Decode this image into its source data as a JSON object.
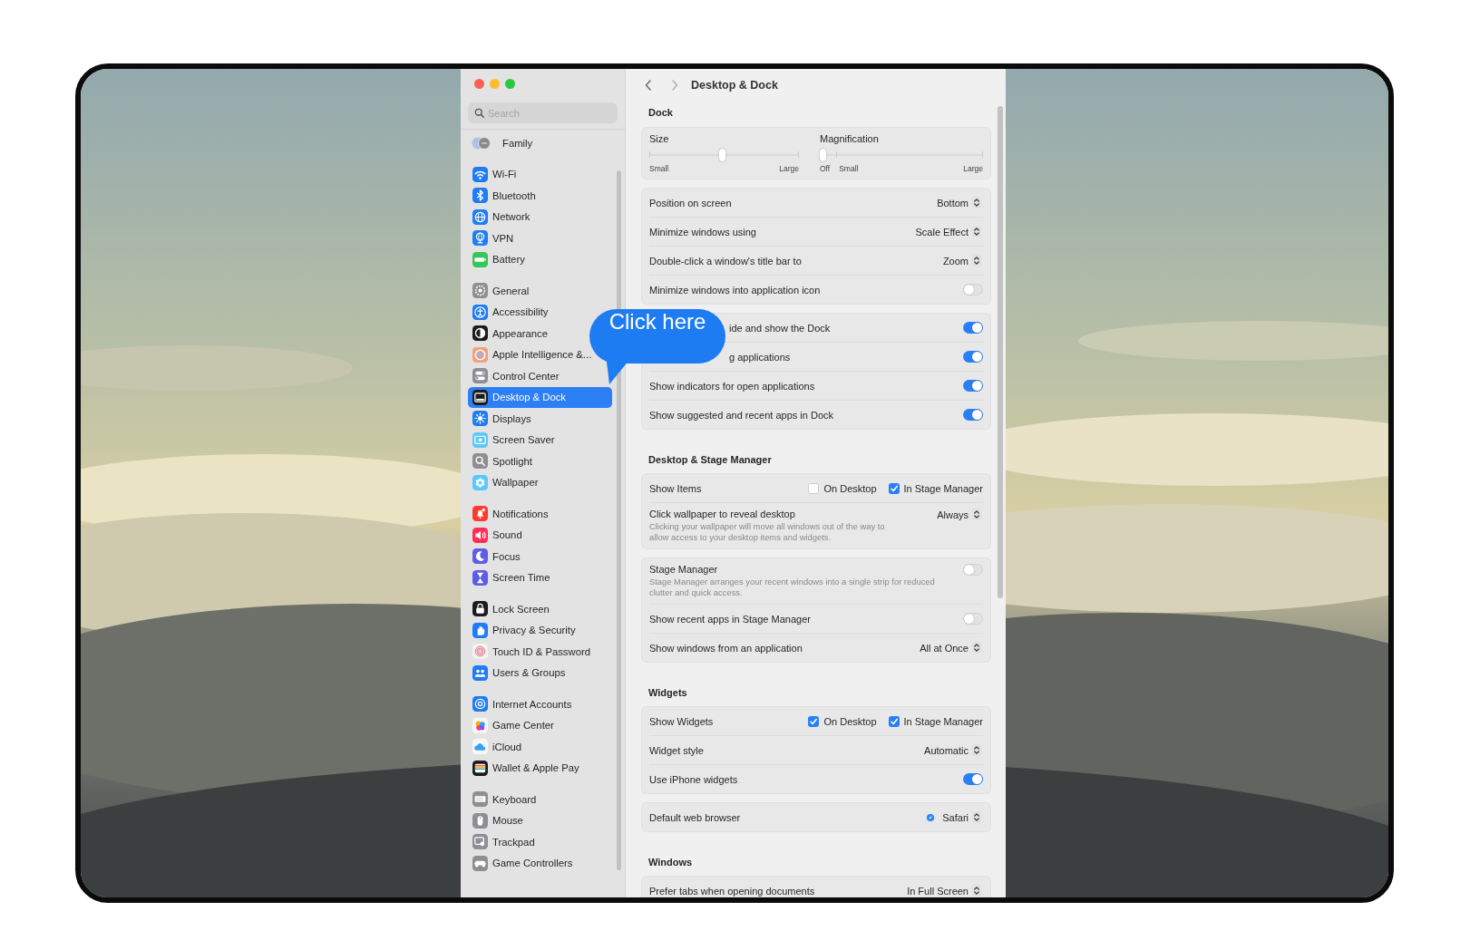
{
  "sidebar": {
    "search": {
      "placeholder": "Search"
    },
    "groups": [
      {
        "items": [
          {
            "label": "Family",
            "kind": "family",
            "selected": false
          }
        ]
      },
      {
        "items": [
          {
            "label": "Wi-Fi",
            "kind": "wifi",
            "color": "#1f7cf5",
            "selected": false
          },
          {
            "label": "Bluetooth",
            "kind": "bluetooth",
            "color": "#1f7cf5",
            "selected": false
          },
          {
            "label": "Network",
            "kind": "globe",
            "color": "#1f7cf5",
            "selected": false
          },
          {
            "label": "VPN",
            "kind": "vpn",
            "color": "#1f7cf5",
            "selected": false
          },
          {
            "label": "Battery",
            "kind": "battery",
            "color": "#34c759",
            "selected": false
          }
        ]
      },
      {
        "items": [
          {
            "label": "General",
            "kind": "gear",
            "color": "#8e8e93",
            "selected": false
          },
          {
            "label": "Accessibility",
            "kind": "accessibility",
            "color": "#1f7cf5",
            "selected": false
          },
          {
            "label": "Appearance",
            "kind": "contrast",
            "color": "#1c1c1e",
            "selected": false
          },
          {
            "label": "Apple Intelligence &...",
            "kind": "swirl",
            "color": "#f3a07a",
            "selected": false
          },
          {
            "label": "Control Center",
            "kind": "toggles",
            "color": "#8e8e93",
            "selected": false
          },
          {
            "label": "Desktop & Dock",
            "kind": "dock",
            "color": "#1c1c1e",
            "selected": true
          },
          {
            "label": "Displays",
            "kind": "sun",
            "color": "#1f7cf5",
            "selected": false
          },
          {
            "label": "Screen Saver",
            "kind": "screen",
            "color": "#5ac8fa",
            "selected": false
          },
          {
            "label": "Spotlight",
            "kind": "search",
            "color": "#8e8e93",
            "selected": false
          },
          {
            "label": "Wallpaper",
            "kind": "flower",
            "color": "#5ac8fa",
            "selected": false
          }
        ]
      },
      {
        "items": [
          {
            "label": "Notifications",
            "kind": "bell",
            "color": "#ff3b30",
            "selected": false
          },
          {
            "label": "Sound",
            "kind": "speaker",
            "color": "#ff2d55",
            "selected": false
          },
          {
            "label": "Focus",
            "kind": "moon",
            "color": "#5e5ce6",
            "selected": false
          },
          {
            "label": "Screen Time",
            "kind": "hourglass",
            "color": "#5e5ce6",
            "selected": false
          }
        ]
      },
      {
        "items": [
          {
            "label": "Lock Screen",
            "kind": "lock",
            "color": "#1c1c1e",
            "selected": false
          },
          {
            "label": "Privacy & Security",
            "kind": "hand",
            "color": "#1f7cf5",
            "selected": false
          },
          {
            "label": "Touch ID & Password",
            "kind": "fingerprint",
            "color": "#f2f2f2",
            "selected": false
          },
          {
            "label": "Users & Groups",
            "kind": "people",
            "color": "#1f7cf5",
            "selected": false
          }
        ]
      },
      {
        "items": [
          {
            "label": "Internet Accounts",
            "kind": "at",
            "color": "#1f7cf5",
            "selected": false
          },
          {
            "label": "Game Center",
            "kind": "bubbles",
            "color": "#f7f7f7",
            "selected": false
          },
          {
            "label": "iCloud",
            "kind": "cloud",
            "color": "#f7f7f7",
            "selected": false
          },
          {
            "label": "Wallet & Apple Pay",
            "kind": "wallet",
            "color": "#1c1c1e",
            "selected": false
          }
        ]
      },
      {
        "items": [
          {
            "label": "Keyboard",
            "kind": "keyboard",
            "color": "#8e8e93",
            "selected": false
          },
          {
            "label": "Mouse",
            "kind": "mouse",
            "color": "#8e8e93",
            "selected": false
          },
          {
            "label": "Trackpad",
            "kind": "trackpad",
            "color": "#8e8e93",
            "selected": false
          },
          {
            "label": "Game Controllers",
            "kind": "gamepad",
            "color": "#8e8e93",
            "selected": false
          }
        ]
      }
    ]
  },
  "toolbar": {
    "title": "Desktop & Dock"
  },
  "sections": [
    {
      "heading": "Dock",
      "cards": [
        {
          "kind": "sliders",
          "sliders": [
            {
              "label": "Size",
              "level": 0.49,
              "ticks": [
                "Small",
                "Large"
              ]
            },
            {
              "label": "Magnification",
              "level": 0,
              "ticks": [
                "Off",
                "Small",
                "Large"
              ]
            }
          ]
        },
        {
          "kind": "rows",
          "rows": [
            {
              "kind": "popup",
              "label": "Position on screen",
              "value": "Bottom"
            },
            {
              "kind": "popup",
              "label": "Minimize windows using",
              "value": "Scale Effect"
            },
            {
              "kind": "popup",
              "label": "Double-click a window's title bar to",
              "value": "Zoom"
            },
            {
              "kind": "toggle",
              "label": "Minimize windows into application icon",
              "on": false
            }
          ]
        },
        {
          "kind": "rows",
          "rows": [
            {
              "kind": "toggle",
              "label": "ide and show the Dock",
              "on": true,
              "overlaid": true
            },
            {
              "kind": "toggle",
              "label": "g applications",
              "on": true,
              "overlaid": true
            },
            {
              "kind": "toggle",
              "label": "Show indicators for open applications",
              "on": true
            },
            {
              "kind": "toggle",
              "label": "Show suggested and recent apps in Dock",
              "on": true
            }
          ]
        }
      ]
    },
    {
      "heading": "Desktop & Stage Manager",
      "cards": [
        {
          "kind": "rows",
          "rows": [
            {
              "kind": "checks",
              "label": "Show Items",
              "options": [
                {
                  "label": "On Desktop",
                  "checked": false
                },
                {
                  "label": "In Stage Manager",
                  "checked": true
                }
              ]
            },
            {
              "kind": "popup",
              "label": "Click wallpaper to reveal desktop",
              "value": "Always",
              "description": "Clicking your wallpaper will move all windows out of the way to allow access to your desktop items and widgets."
            }
          ]
        },
        {
          "kind": "rows",
          "rows": [
            {
              "kind": "toggle",
              "label": "Stage Manager",
              "on": false,
              "description": "Stage Manager arranges your recent windows into a single strip for reduced clutter and quick access."
            },
            {
              "kind": "toggle",
              "label": "Show recent apps in Stage Manager",
              "on": false
            },
            {
              "kind": "popup",
              "label": "Show windows from an application",
              "value": "All at Once"
            }
          ]
        }
      ]
    },
    {
      "heading": "Widgets",
      "cards": [
        {
          "kind": "rows",
          "rows": [
            {
              "kind": "checks",
              "label": "Show Widgets",
              "options": [
                {
                  "label": "On Desktop",
                  "checked": true
                },
                {
                  "label": "In Stage Manager",
                  "checked": true
                }
              ]
            },
            {
              "kind": "popup",
              "label": "Widget style",
              "value": "Automatic"
            },
            {
              "kind": "toggle",
              "label": "Use iPhone widgets",
              "on": true
            }
          ]
        },
        {
          "kind": "rows",
          "rows": [
            {
              "kind": "app-popup",
              "label": "Default web browser",
              "value": "Safari"
            }
          ]
        }
      ]
    },
    {
      "heading": "Windows",
      "cards": [
        {
          "kind": "rows",
          "rows": [
            {
              "kind": "popup",
              "label": "Prefer tabs when opening documents",
              "value": "In Full Screen"
            }
          ]
        }
      ]
    }
  ],
  "callout": {
    "text": "Click here"
  }
}
